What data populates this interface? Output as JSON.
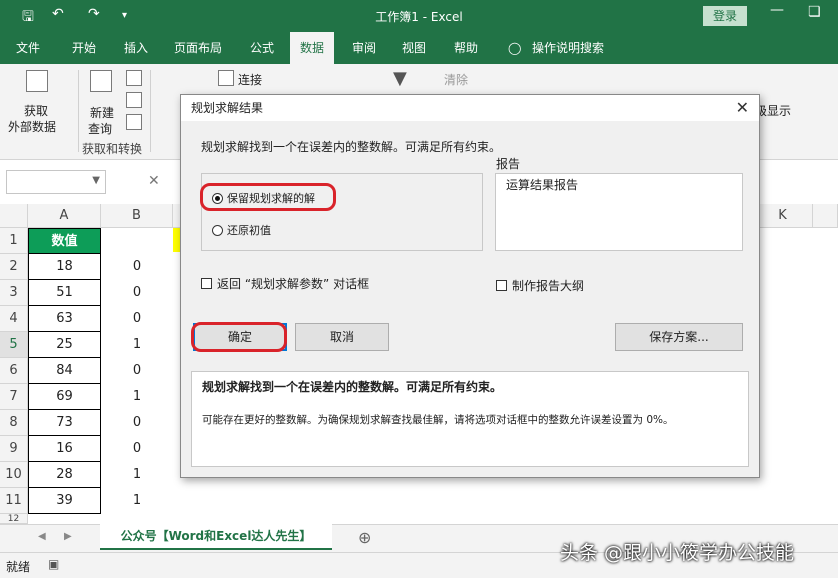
{
  "window": {
    "title": "工作簿1  -  Excel",
    "login": "登录",
    "min_icon": "minimize-icon",
    "restore_icon": "restore-icon",
    "close_icon": "close-icon"
  },
  "menu_tabs": [
    "文件",
    "开始",
    "插入",
    "页面布局",
    "公式",
    "数据",
    "审阅",
    "视图",
    "帮助",
    "操作说明搜索"
  ],
  "active_tab": "数据",
  "ribbon": {
    "get_data_line1": "获取",
    "get_data_line2": "外部数据",
    "new_query_line1": "新建",
    "new_query_line2": "查询",
    "connections": "连接",
    "clear": "清除",
    "partial_label": "级显示",
    "group_get_transform": "获取和转换"
  },
  "columns": [
    "A",
    "B",
    "K"
  ],
  "sheet": {
    "header_cell": "数值",
    "rows": [
      {
        "row": "1",
        "a": "",
        "b": ""
      },
      {
        "row": "2",
        "a": "18",
        "b": "0"
      },
      {
        "row": "3",
        "a": "51",
        "b": "0"
      },
      {
        "row": "4",
        "a": "63",
        "b": "0"
      },
      {
        "row": "5",
        "a": "25",
        "b": "1"
      },
      {
        "row": "6",
        "a": "84",
        "b": "0"
      },
      {
        "row": "7",
        "a": "69",
        "b": "1"
      },
      {
        "row": "8",
        "a": "73",
        "b": "0"
      },
      {
        "row": "9",
        "a": "16",
        "b": "0"
      },
      {
        "row": "10",
        "a": "28",
        "b": "1"
      },
      {
        "row": "11",
        "a": "39",
        "b": "1"
      }
    ],
    "row_12": "12"
  },
  "sheet_tab": "公众号【Word和Excel达人先生】",
  "status": "就绪",
  "watermark": "头条 @跟小小筱学办公技能",
  "dialog": {
    "title": "规划求解结果",
    "message": "规划求解找到一个在误差内的整数解。可满足所有约束。",
    "option_keep": "保留规划求解的解",
    "option_restore": "还原初值",
    "report_label": "报告",
    "report_item": "运算结果报告",
    "return_checkbox": "返回 “规划求解参数” 对话框",
    "outline_checkbox": "制作报告大纲",
    "ok": "确定",
    "cancel": "取消",
    "save_scenario": "保存方案...",
    "result_title": "规划求解找到一个在误差内的整数解。可满足所有约束。",
    "result_detail": "可能存在更好的整数解。为确保规划求解查找最佳解，请将选项对话框中的整数允许误差设置为 0%。"
  }
}
